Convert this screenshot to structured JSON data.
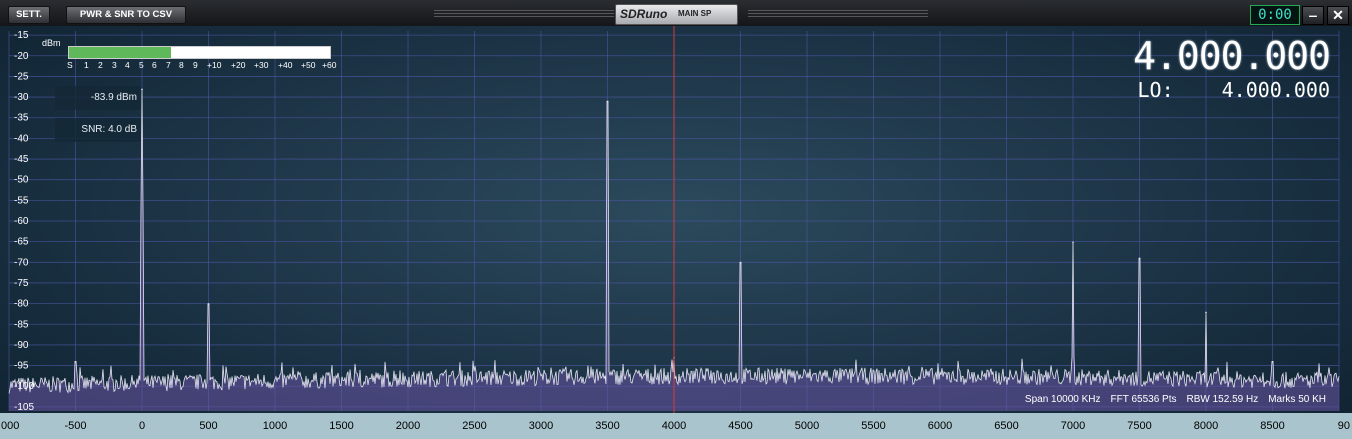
{
  "titlebar": {
    "settings_label": "SETT.",
    "export_label": "PWR & SNR TO CSV",
    "app_name": "SDRuno",
    "panel_name": "MAIN SP",
    "clock": "0:00",
    "minimize_label": "‒",
    "close_label": "✕"
  },
  "smeter": {
    "unit": "dBm",
    "scale": [
      "S",
      "1",
      "2",
      "3",
      "4",
      "5",
      "6",
      "7",
      "8",
      "9",
      "+10",
      "+20",
      "+30",
      "+40",
      "+50",
      "+60"
    ],
    "level_fraction": 0.39,
    "fill_color": "#5fb85a"
  },
  "readouts": {
    "power": "-83.9 dBm",
    "snr": "SNR: 4.0 dB"
  },
  "frequency": {
    "main": "4.000.000",
    "lo_label": "LO:",
    "lo_value": "4.000.000"
  },
  "info": {
    "span": "Span 10000 KHz",
    "fft": "FFT 65536 Pts",
    "rbw": "RBW 152.59 Hz",
    "marks": "Marks 50 KH"
  },
  "colors": {
    "center_marker": "#d83a3a",
    "trace": "#e6e6f2",
    "fill": "#6b56a6",
    "grid": "#4f57a8"
  },
  "chart_data": {
    "type": "line",
    "x_tick_labels": [
      "000",
      "-500",
      "0",
      "500",
      "1000",
      "1500",
      "2000",
      "2500",
      "3000",
      "3500",
      "4000",
      "4500",
      "5000",
      "5500",
      "6000",
      "6500",
      "7000",
      "7500",
      "8000",
      "8500",
      "90"
    ],
    "y_tick_labels": [
      "-15",
      "-20",
      "-25",
      "-30",
      "-35",
      "-40",
      "-45",
      "-50",
      "-55",
      "-60",
      "-65",
      "-70",
      "-75",
      "-80",
      "-85",
      "-90",
      "-95",
      "-100",
      "-105"
    ],
    "xlim": [
      -1000,
      9000
    ],
    "ylim": [
      -106,
      -14
    ],
    "xlabel": "",
    "ylabel": "",
    "center_frequency_khz": 4000,
    "noise_floor_dbm": -97.5,
    "peaks": [
      {
        "x": -500,
        "y": -94
      },
      {
        "x": 0,
        "y": -28
      },
      {
        "x": 500,
        "y": -80
      },
      {
        "x": 3500,
        "y": -31
      },
      {
        "x": 4000,
        "y": -93
      },
      {
        "x": 4500,
        "y": -70
      },
      {
        "x": 7000,
        "y": -65
      },
      {
        "x": 7500,
        "y": -69
      },
      {
        "x": 8000,
        "y": -82
      },
      {
        "x": 8500,
        "y": -94
      }
    ]
  }
}
